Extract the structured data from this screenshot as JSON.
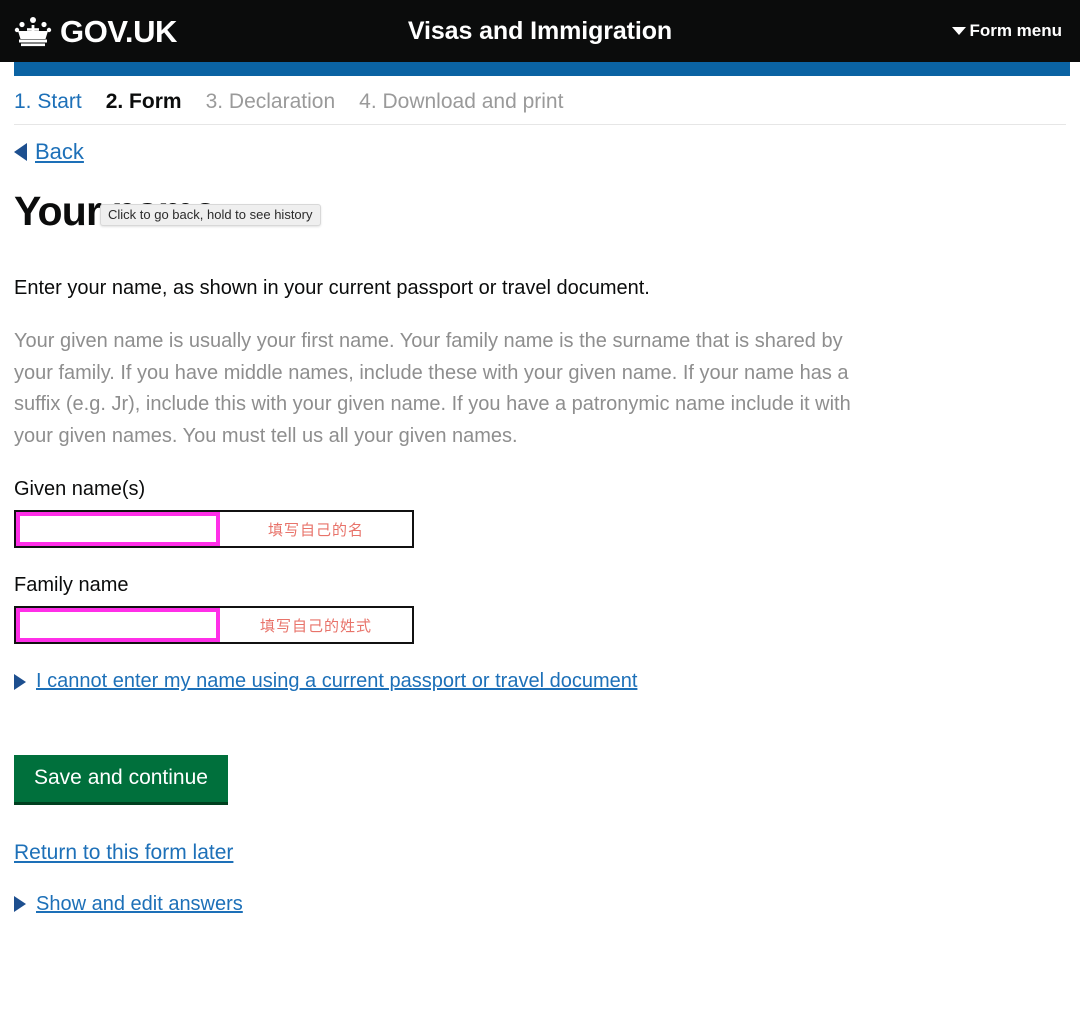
{
  "header": {
    "brand": "GOV.UK",
    "crown_icon": "crown-icon",
    "service_title": "Visas and Immigration",
    "form_menu_label": "Form menu",
    "caret_icon": "chevron-down-icon"
  },
  "steps": [
    {
      "label": "1. Start",
      "state": "link"
    },
    {
      "label": "2. Form",
      "state": "current"
    },
    {
      "label": "3. Declaration",
      "state": "muted"
    },
    {
      "label": "4. Download and print",
      "state": "muted"
    }
  ],
  "tooltip": {
    "text": "Click to go back, hold to see history"
  },
  "back": {
    "label": "Back",
    "icon": "chevron-left-icon"
  },
  "main": {
    "title": "Your name",
    "lede": "Enter your name, as shown in your current passport or travel document.",
    "hint": "Your given name is usually your first name. Your family name is the surname that is shared by your family. If you have middle names, include these with your given name. If your name has a suffix (e.g. Jr), include this with your given name. If you have a patronymic name include it with your given names. You must tell us all your given names."
  },
  "fields": [
    {
      "label": "Given name(s)",
      "value": "",
      "placeholder": "",
      "annotation": "填写自己的名"
    },
    {
      "label": "Family name",
      "value": "",
      "placeholder": "",
      "annotation": "填写自己的姓式"
    }
  ],
  "details_link": {
    "label": "I cannot enter my name using a current passport or travel document",
    "icon": "disclosure-triangle-icon"
  },
  "actions": {
    "submit_label": "Save and continue",
    "return_label": "Return to this form later",
    "show_answers_label": "Show and edit answers",
    "show_answers_icon": "disclosure-triangle-icon"
  },
  "colors": {
    "header_black": "#0b0c0c",
    "phase_blue": "#0b63a3",
    "link_blue": "#1d70b8",
    "govuk_green": "#00703c",
    "highlight_magenta": "#ff2fe8",
    "annotation_red": "#e8736a",
    "muted_grey": "#8e8e8e"
  }
}
